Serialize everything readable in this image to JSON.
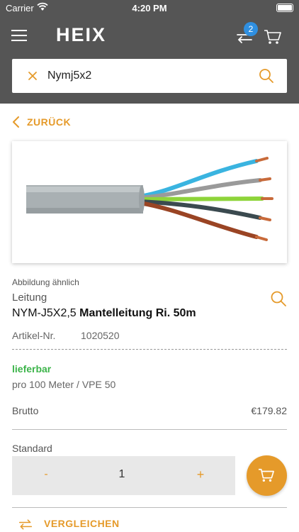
{
  "status_bar": {
    "carrier": "Carrier",
    "time": "4:20 PM"
  },
  "navbar": {
    "logo": "HEIX",
    "compare_badge": "2"
  },
  "search": {
    "value": "Nymj5x2",
    "placeholder": ""
  },
  "back_label": "ZURÜCK",
  "product": {
    "image_caption": "Abbildung ähnlich",
    "category": "Leitung",
    "title_code": "NYM-J5X2,5",
    "title_name": "Mantelleitung Ri. 50m",
    "article_label": "Artikel-Nr.",
    "article_number": "1020520",
    "availability": "lieferbar",
    "unit_info": "pro 100 Meter  / VPE 50",
    "price_label": "Brutto",
    "price": "€179.82",
    "quantity_label": "Standard",
    "quantity": "1",
    "minus": "-",
    "plus": "+"
  },
  "compare_label": "VERGLEICHEN",
  "colors": {
    "accent": "#e59a2a",
    "header": "#555555",
    "available": "#3cb44a",
    "badge": "#2f8fe0"
  },
  "cable_wire_colors": [
    "#3ab4e0",
    "#9a9a9a",
    "#8ed43a",
    "#3b4a4f",
    "#9a4424"
  ]
}
